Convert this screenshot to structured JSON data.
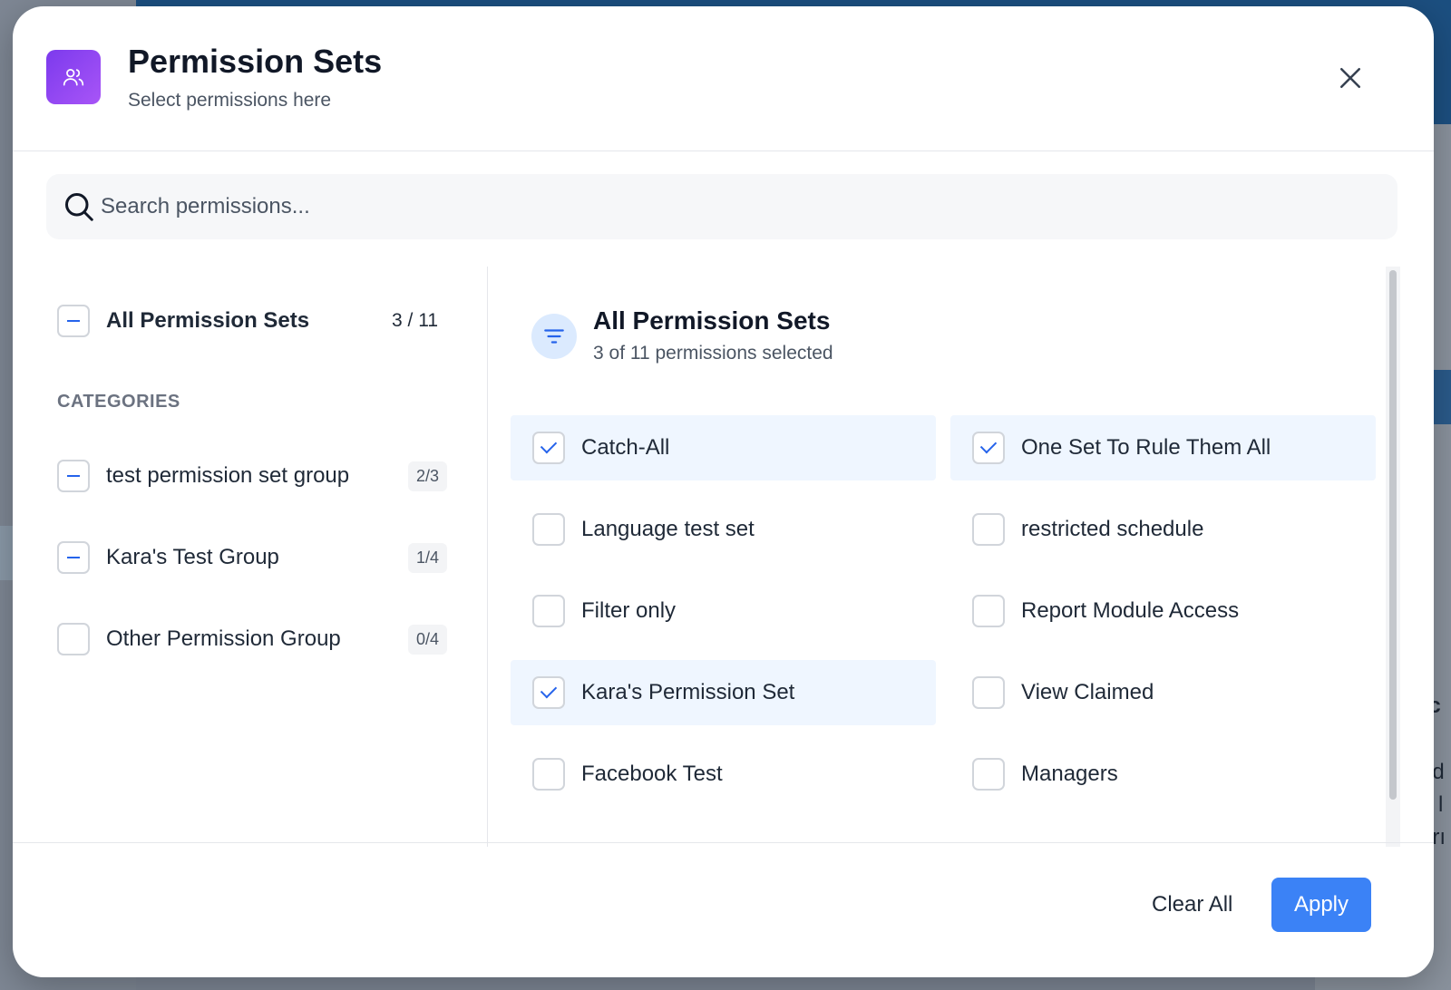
{
  "dialog": {
    "title": "Permission Sets",
    "subtitle": "Select permissions here",
    "icon": "users-icon",
    "accent": "#7c3aed"
  },
  "search": {
    "placeholder": "Search permissions..."
  },
  "sidebar": {
    "all": {
      "label": "All Permission Sets",
      "count": "3 / 11",
      "state": "partial"
    },
    "categories_heading": "CATEGORIES",
    "categories": [
      {
        "label": "test permission set group",
        "count": "2/3",
        "state": "partial"
      },
      {
        "label": "Kara's Test Group",
        "count": "1/4",
        "state": "partial"
      },
      {
        "label": "Other Permission Group",
        "count": "0/4",
        "state": "unchecked"
      }
    ]
  },
  "main": {
    "title": "All Permission Sets",
    "subtitle": "3 of 11 permissions selected",
    "icon": "filter-icon",
    "items": [
      {
        "label": "Catch-All",
        "checked": true
      },
      {
        "label": "One Set To Rule Them All",
        "checked": true
      },
      {
        "label": "Language test set",
        "checked": false
      },
      {
        "label": "restricted schedule",
        "checked": false
      },
      {
        "label": "Filter only",
        "checked": false
      },
      {
        "label": "Report Module Access",
        "checked": false
      },
      {
        "label": "Kara's Permission Set",
        "checked": true
      },
      {
        "label": "View Claimed",
        "checked": false
      },
      {
        "label": "Facebook Test",
        "checked": false
      },
      {
        "label": "Managers",
        "checked": false
      }
    ]
  },
  "footer": {
    "clear_label": "Clear All",
    "apply_label": "Apply",
    "apply_color": "#3b82f6"
  },
  "background": {
    "fragments": [
      "rc",
      "ed",
      "a l",
      "orı"
    ]
  }
}
